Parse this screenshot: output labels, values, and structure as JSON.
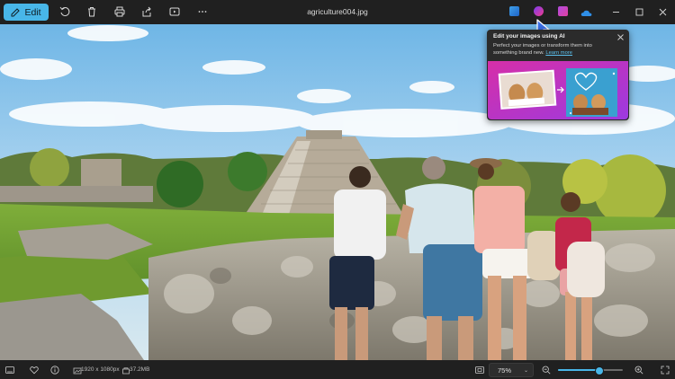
{
  "toolbar": {
    "edit_label": "Edit",
    "file_name": "agriculture004.jpg",
    "icons": [
      "rotate-icon",
      "delete-icon",
      "print-icon",
      "share-icon",
      "slideshow-icon",
      "more-icon"
    ],
    "apps": [
      "designer-app-icon",
      "clipchamp-app-icon",
      "paint-app-icon",
      "onedrive-icon"
    ],
    "window_controls": [
      "minimize-icon",
      "maximize-icon",
      "close-icon"
    ]
  },
  "popup": {
    "title": "Edit your images using AI",
    "body": "Perfect your images or transform them into something brand new.",
    "link": "Learn more"
  },
  "status": {
    "resolution": "1920 x 1080px",
    "file_size": "37.2MB"
  },
  "zoom": {
    "value": "75%",
    "level": 0.62
  },
  "colors": {
    "accent": "#48b6e8",
    "toolbar_bg": "#202020",
    "popup_bg": "#2b2b2b"
  }
}
